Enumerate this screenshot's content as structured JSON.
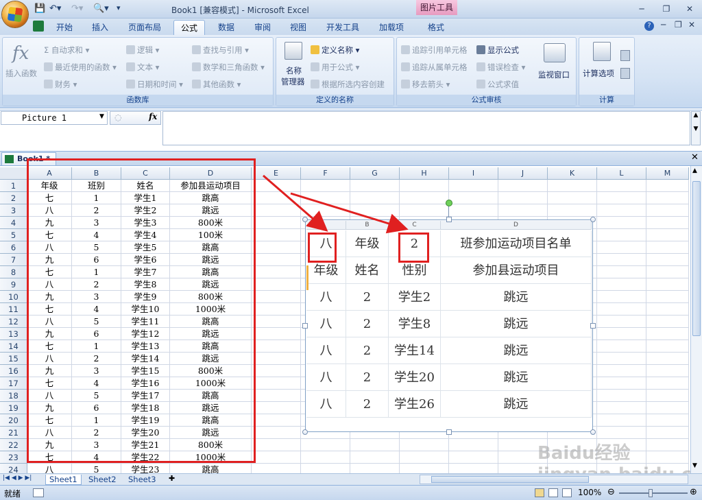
{
  "title_bar": {
    "title": "Book1 [兼容模式] - Microsoft Excel",
    "contextual_group": "图片工具"
  },
  "tabs": [
    "开始",
    "插入",
    "页面布局",
    "公式",
    "数据",
    "审阅",
    "视图",
    "开发工具",
    "加载项",
    "格式"
  ],
  "active_tab": "公式",
  "ribbon": {
    "groups": [
      {
        "title": "函数库",
        "items": [
          "插入函数",
          "自动求和",
          "最近使用的函数",
          "财务",
          "逻辑",
          "文本",
          "日期和时间",
          "查找与引用",
          "数学和三角函数",
          "其他函数"
        ]
      },
      {
        "title": "定义的名称",
        "items": [
          "名称",
          "管理器",
          "定义名称",
          "用于公式",
          "根据所选内容创建"
        ]
      },
      {
        "title": "公式审核",
        "items": [
          "追踪引用单元格",
          "追踪从属单元格",
          "移去箭头",
          "显示公式",
          "错误检查",
          "公式求值",
          "监视窗口"
        ]
      },
      {
        "title": "计算",
        "items": [
          "计算选项"
        ]
      }
    ]
  },
  "name_box": "Picture 1",
  "fx_label": "fx",
  "workbook_tab": "Book1 *",
  "columns": [
    "A",
    "B",
    "C",
    "D",
    "E",
    "F",
    "G",
    "H",
    "I",
    "J",
    "K",
    "L",
    "M"
  ],
  "rows": [
    [
      "年级",
      "班别",
      "姓名",
      "参加县运动项目"
    ],
    [
      "七",
      "1",
      "学生1",
      "跳高"
    ],
    [
      "八",
      "2",
      "学生2",
      "跳远"
    ],
    [
      "九",
      "3",
      "学生3",
      "800米"
    ],
    [
      "七",
      "4",
      "学生4",
      "100米"
    ],
    [
      "八",
      "5",
      "学生5",
      "跳高"
    ],
    [
      "九",
      "6",
      "学生6",
      "跳远"
    ],
    [
      "七",
      "1",
      "学生7",
      "跳高"
    ],
    [
      "八",
      "2",
      "学生8",
      "跳远"
    ],
    [
      "九",
      "3",
      "学生9",
      "800米"
    ],
    [
      "七",
      "4",
      "学生10",
      "1000米"
    ],
    [
      "八",
      "5",
      "学生11",
      "跳高"
    ],
    [
      "九",
      "6",
      "学生12",
      "跳远"
    ],
    [
      "七",
      "1",
      "学生13",
      "跳高"
    ],
    [
      "八",
      "2",
      "学生14",
      "跳远"
    ],
    [
      "九",
      "3",
      "学生15",
      "800米"
    ],
    [
      "七",
      "4",
      "学生16",
      "1000米"
    ],
    [
      "八",
      "5",
      "学生17",
      "跳高"
    ],
    [
      "九",
      "6",
      "学生18",
      "跳远"
    ],
    [
      "七",
      "1",
      "学生19",
      "跳高"
    ],
    [
      "八",
      "2",
      "学生20",
      "跳远"
    ],
    [
      "九",
      "3",
      "学生21",
      "800米"
    ],
    [
      "七",
      "4",
      "学生22",
      "1000米"
    ],
    [
      "八",
      "5",
      "学生23",
      "跳高"
    ]
  ],
  "picture": {
    "columns": [
      "",
      "B",
      "C",
      "D"
    ],
    "header_row": [
      "八",
      "年级",
      "2",
      "班参加运动项目名单"
    ],
    "sub_header": [
      "年级",
      "姓名",
      "性别",
      "参加县运动项目"
    ],
    "rows": [
      [
        "八",
        "2",
        "学生2",
        "跳远"
      ],
      [
        "八",
        "2",
        "学生8",
        "跳远"
      ],
      [
        "八",
        "2",
        "学生14",
        "跳远"
      ],
      [
        "八",
        "2",
        "学生20",
        "跳远"
      ],
      [
        "八",
        "2",
        "学生26",
        "跳远"
      ]
    ]
  },
  "sheet_tabs": [
    "Sheet1",
    "Sheet2",
    "Sheet3"
  ],
  "status": {
    "ready": "就绪",
    "zoom": "100%"
  },
  "watermark": "Baidu经验 jingyan.baidu.com",
  "colors": {
    "highlight": "#e02020",
    "ribbon": "#d5e3f4"
  }
}
